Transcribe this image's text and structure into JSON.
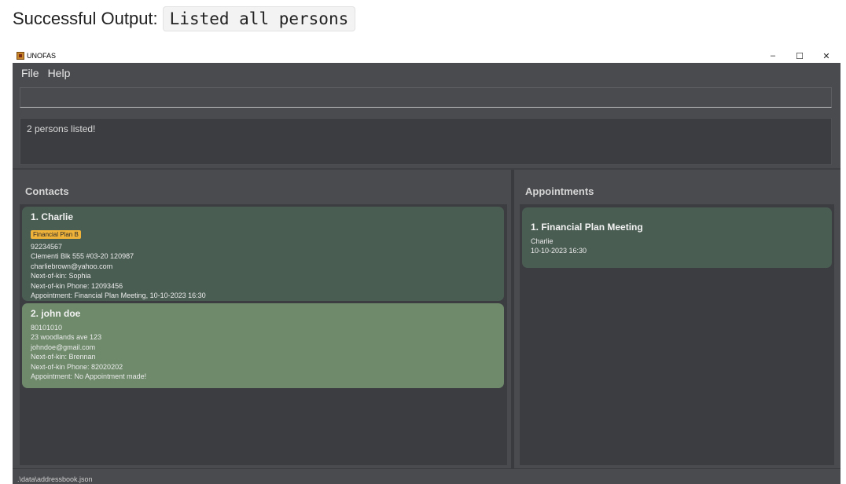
{
  "caption": {
    "label": "Successful Output:",
    "command": "Listed all persons"
  },
  "window": {
    "title": "UNOFAS",
    "controls": {
      "minimize": "–",
      "maximize": "☐",
      "close": "✕"
    }
  },
  "menu": {
    "file": "File",
    "help": "Help"
  },
  "command_box": {
    "value": "",
    "placeholder": ""
  },
  "result": {
    "message": "2 persons listed!"
  },
  "contacts": {
    "title": "Contacts",
    "items": [
      {
        "index_name": "1.  Charlie",
        "tag": "Financial Plan B",
        "phone": "92234567",
        "address": "Clementi Blk 555 #03-20 120987",
        "email": "charliebrown@yahoo.com",
        "next_of_kin": "Next-of-kin: Sophia",
        "next_of_kin_phone": "Next-of-kin Phone: 12093456",
        "appointment": "Appointment: Financial Plan Meeting, 10-10-2023 16:30"
      },
      {
        "index_name": "2.  john doe",
        "phone": "80101010",
        "address": "23 woodlands ave 123",
        "email": "johndoe@gmail.com",
        "next_of_kin": "Next-of-kin: Brennan",
        "next_of_kin_phone": "Next-of-kin Phone: 82020202",
        "appointment": "Appointment: No Appointment made!"
      }
    ]
  },
  "appointments": {
    "title": "Appointments",
    "items": [
      {
        "index_name": "1.  Financial Plan Meeting",
        "person": "Charlie",
        "datetime": "10-10-2023 16:30"
      }
    ]
  },
  "status": {
    "path": ".\\data\\addressbook.json"
  },
  "colors": {
    "window_bg": "#3f4044",
    "panel_bg": "#4a4b4f",
    "card_selected": "#4a5d53",
    "card_other": "#6e8a6b",
    "tag_bg": "#f0b33a"
  }
}
